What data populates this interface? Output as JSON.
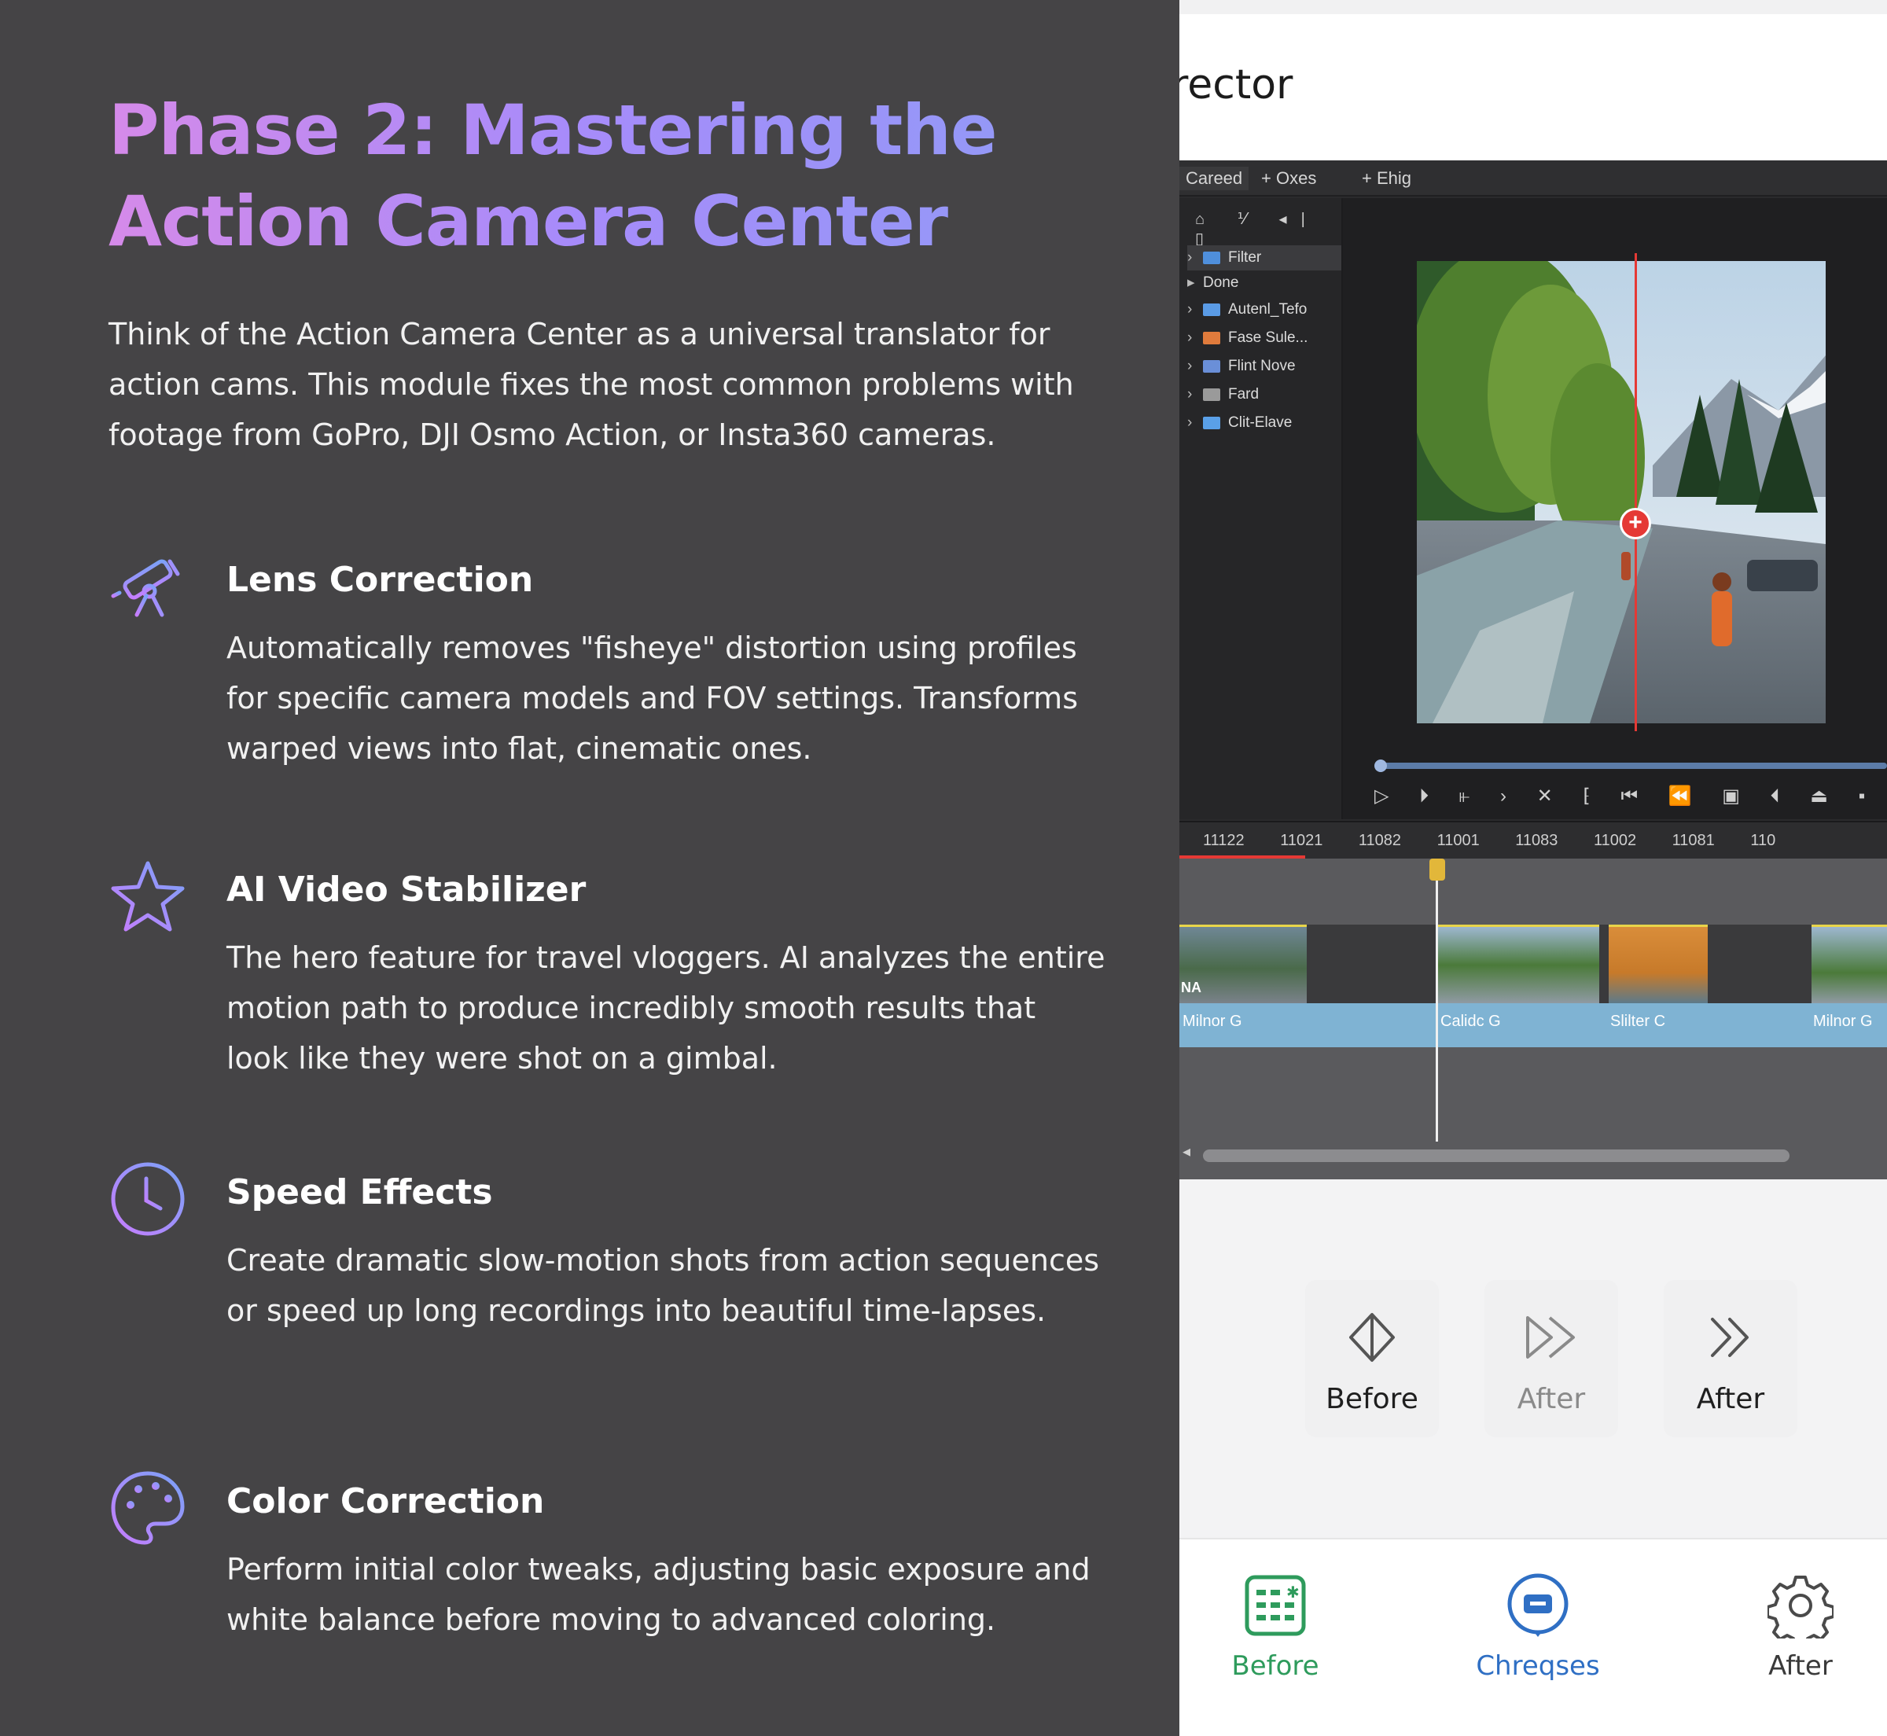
{
  "title": "Phase 2: Mastering the Action Camera Center",
  "intro": "Think of the Action Camera Center as a universal translator for action cams. This module fixes the most common problems with footage from GoPro, DJI Osmo Action, or Insta360 cameras.",
  "features": [
    {
      "icon": "telescope-icon",
      "heading": "Lens Correction",
      "body": "Automatically removes \"fisheye\" distortion using profiles for specific camera models and FOV settings. Transforms warped views into flat, cinematic ones."
    },
    {
      "icon": "star-icon",
      "heading": "AI Video Stabilizer",
      "body": "The hero feature for travel vloggers. AI analyzes the entire motion path to produce incredibly smooth results that look like they were shot on a gimbal."
    },
    {
      "icon": "clock-icon",
      "heading": "Speed Effects",
      "body": "Create dramatic slow-motion shots from action sequences or speed up long recordings into beautiful time-lapses."
    },
    {
      "icon": "palette-icon",
      "heading": "Color Correction",
      "body": "Perform initial color tweaks, adjusting basic exposure and white balance before moving to advanced coloring."
    }
  ],
  "screenshot": {
    "brand": "rector",
    "tabs": [
      "Careed",
      "Oxes",
      "Ehig"
    ],
    "browser_items": [
      {
        "label": "Filter",
        "selected": true
      },
      {
        "label": "Done"
      },
      {
        "label": "Autenl_Tefo"
      },
      {
        "label": "Fase Sule..."
      },
      {
        "label": "Flint Nove"
      },
      {
        "label": "Fard"
      },
      {
        "label": "Clit-Elave"
      }
    ],
    "ruler": "11122 11021 11082 11001 11083 11002 11081 110",
    "clip_labels": [
      "Milnor G",
      "Calidc G",
      "Slilter C",
      "Milnor G"
    ],
    "clip_tag": "NA",
    "compare": [
      {
        "label": "Before",
        "icon": "diamond-arrow-icon",
        "faded": false
      },
      {
        "label": "After",
        "icon": "fast-forward-icon",
        "faded": true
      },
      {
        "label": "After",
        "icon": "double-chevron-icon",
        "faded": false
      }
    ],
    "nav": [
      {
        "label": "Before",
        "icon": "grid-icon",
        "color": "#2e9b5c"
      },
      {
        "label": "Chreqses",
        "icon": "chat-icon",
        "color": "#2f6fc4"
      },
      {
        "label": "After",
        "icon": "gear-icon",
        "color": "#3a3a3a"
      }
    ]
  }
}
